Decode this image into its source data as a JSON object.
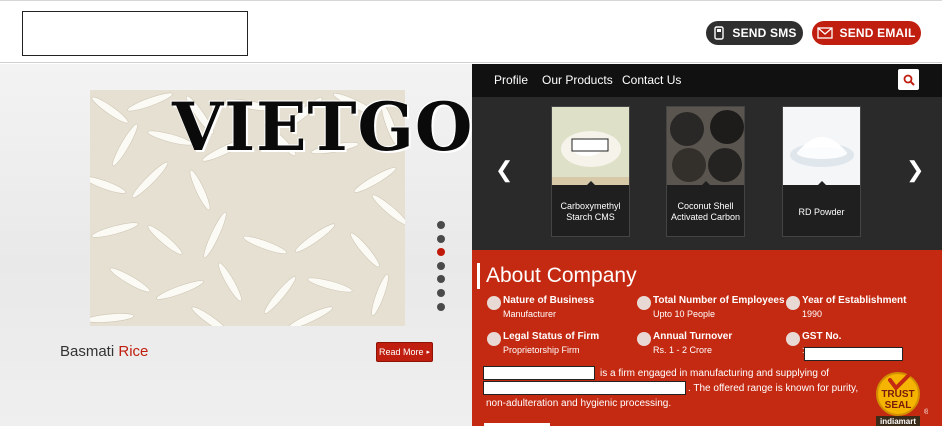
{
  "header": {
    "send_sms": "SEND SMS",
    "send_email": "SEND EMAIL"
  },
  "hero": {
    "watermark": "VIETGO",
    "product_name": "Basmati",
    "product_name_accent": "Rice",
    "read_more": "Read More"
  },
  "nav": {
    "items": [
      "Profile",
      "Our Products",
      "Contact Us"
    ]
  },
  "products": [
    {
      "line1": "Carboxymethyl",
      "line2": "Starch CMS"
    },
    {
      "line1": "Coconut Shell",
      "line2": "Activated Carbon"
    },
    {
      "line1": "RD Powder",
      "line2": ""
    }
  ],
  "about": {
    "title": "About Company",
    "facts": [
      {
        "label": "Nature of Business",
        "value": "Manufacturer"
      },
      {
        "label": "Total Number of Employees",
        "value": "Upto 10 People"
      },
      {
        "label": "Year of Establishment",
        "value": "1990"
      },
      {
        "label": "Legal Status of Firm",
        "value": "Proprietorship Firm"
      },
      {
        "label": "Annual Turnover",
        "value": "Rs. 1 - 2 Crore"
      },
      {
        "label": "GST No.",
        "value": ":"
      }
    ],
    "desc_1": "is a firm engaged in manufacturing and supplying of",
    "desc_2": ". The offered range is known for purity,",
    "desc_3": "non-adulteration and hygienic processing."
  },
  "seal": {
    "line1": "TRUST",
    "line2": "SEAL",
    "brand": "indiamart"
  },
  "colors": {
    "brand_red": "#c42a12",
    "dark": "#111111"
  }
}
